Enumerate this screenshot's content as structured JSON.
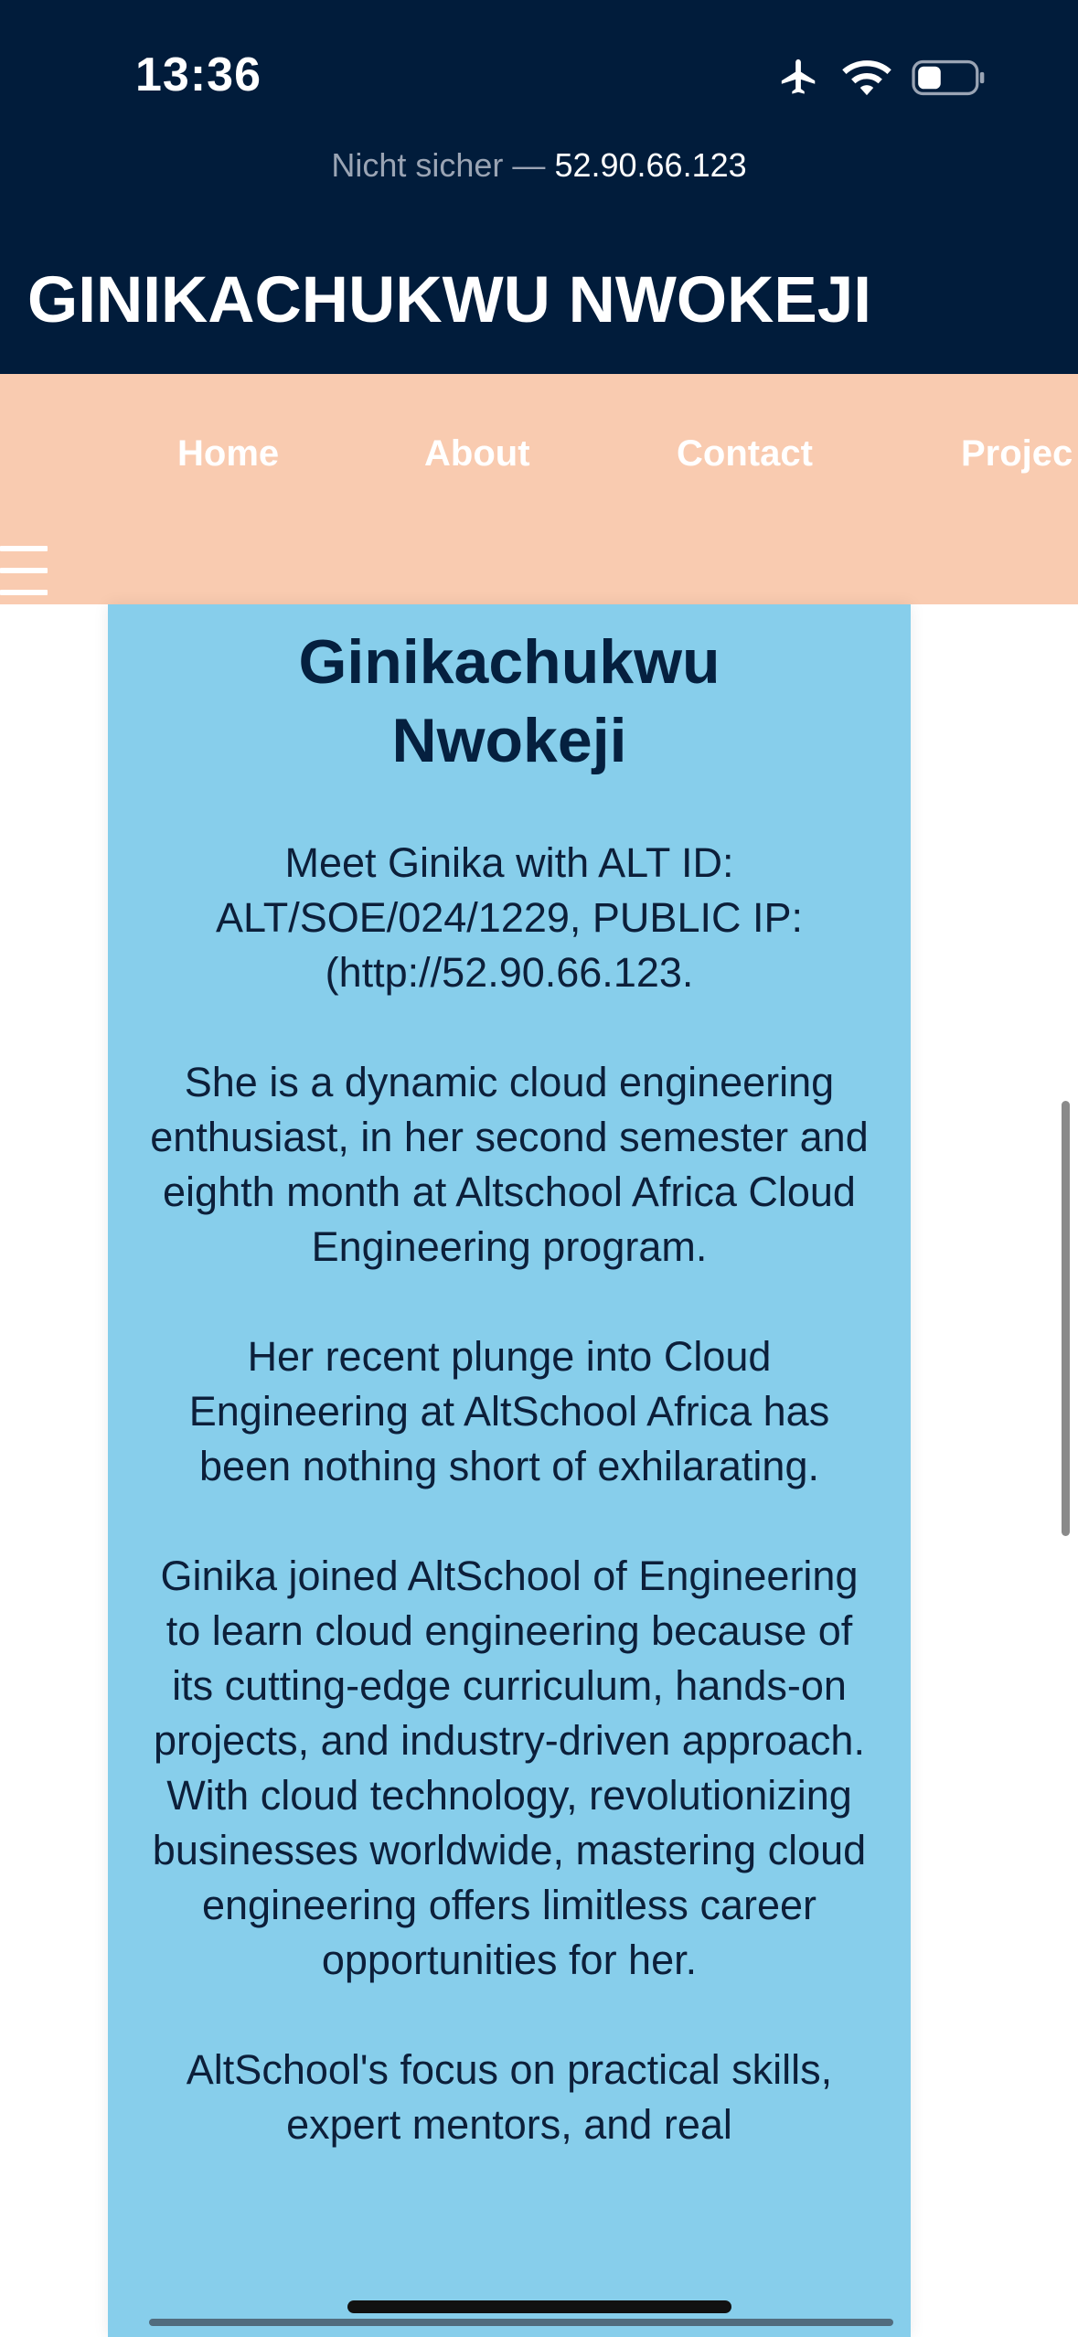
{
  "status_bar": {
    "time": "13:36",
    "icons": [
      "airplane-icon",
      "wifi-icon",
      "battery-icon"
    ]
  },
  "browser": {
    "security_label": "Nicht sicher —",
    "host": "52.90.66.123"
  },
  "site": {
    "title": "GINIKACHUKWU NWOKEJI"
  },
  "nav": {
    "items": [
      {
        "label": "Home"
      },
      {
        "label": "About"
      },
      {
        "label": "Contact"
      },
      {
        "label": "Projec"
      }
    ],
    "menu_icon": "hamburger-icon"
  },
  "card": {
    "heading_line1": "Ginikachukwu",
    "heading_line2": "Nwokeji",
    "paragraphs": [
      "Meet Ginika with ALT ID: ALT/SOE/024/1229, PUBLIC IP: (http://52.90.66.123.",
      "She is a dynamic cloud engineering enthusiast, in her second semester and eighth month at Altschool Africa Cloud Engineering program.",
      "Her recent plunge into Cloud Engineering at AltSchool Africa has been nothing short of exhilarating.",
      "Ginika joined AltSchool of Engineering to learn cloud engineering because of its cutting-edge curriculum, hands-on projects, and industry-driven approach.",
      "With cloud technology, revolutionizing businesses worldwide, mastering cloud engineering offers limitless career opportunities for her.",
      "AltSchool's focus on practical skills, expert mentors, and real"
    ]
  },
  "colors": {
    "header_bg": "#011c3b",
    "nav_bg": "#f9cbb0",
    "card_bg": "#87ceeb",
    "text_dark": "#0c1f3a"
  }
}
